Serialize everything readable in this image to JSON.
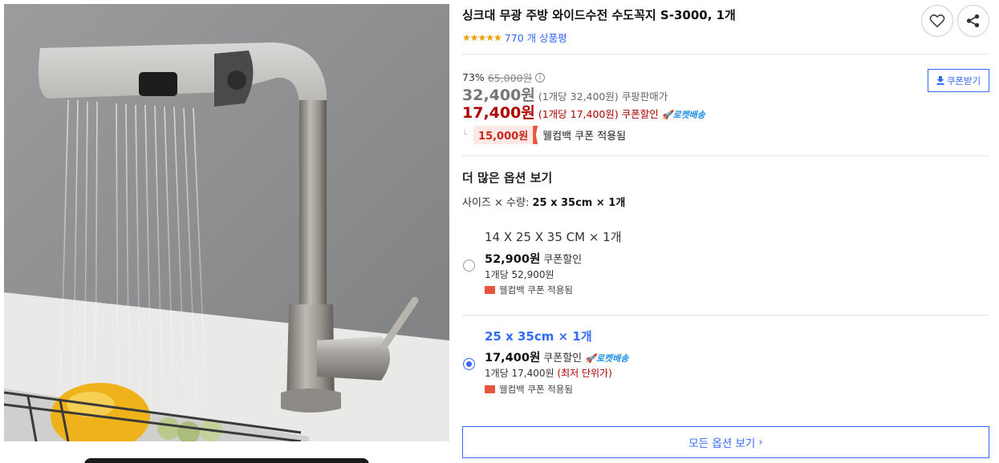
{
  "product": {
    "title": "싱크대 무광 주방 와이드수전 수도꼭지 S-3000, 1개",
    "stars": "★★★★★",
    "review_count": "770 개 상품평"
  },
  "icons": {
    "wishlist": "heart-icon",
    "share": "share-icon",
    "info": "info-icon",
    "download": "download-icon",
    "rocket": "rocket-icon",
    "coupon": "coupon-icon",
    "chevron": "chevron-right-icon"
  },
  "pricing": {
    "discount_rate": "73%",
    "original_price": "65,000원",
    "info_glyph": "i",
    "sale_price": "32,400원",
    "sale_unit": "(1개당 32,400원)",
    "sale_label": "쿠팡판매가",
    "coupon_price": "17,400원",
    "coupon_unit": "(1개당 17,400원)",
    "coupon_label": "쿠폰할인",
    "rocket_label": "🚀로켓배송",
    "coupon_button": "쿠폰받기",
    "welcome_amount": "15,000원",
    "welcome_text": "웰컴백 쿠폰 적용됨"
  },
  "options": {
    "heading": "더 많은 옵션 보기",
    "size_label": "사이즈 × 수량:",
    "size_value": "25 x 35cm × 1개",
    "items": [
      {
        "name": "14 X 25 X 35 CM × 1개",
        "price": "52,900원",
        "discount": "쿠폰할인",
        "unit": "1개당 52,900원",
        "unit_note": "",
        "coupon": "웰컴백 쿠폰 적용됨",
        "selected": false,
        "rocket": ""
      },
      {
        "name": "25 x 35cm × 1개",
        "price": "17,400원",
        "discount": "쿠폰할인",
        "unit": "1개당 17,400원",
        "unit_note": "(최저 단위가)",
        "coupon": "웰컴백 쿠폰 적용됨",
        "selected": true,
        "rocket": "🚀로켓배송"
      }
    ],
    "all_button": "모든 옵션 보기",
    "chevron": "›"
  },
  "colors": {
    "accent": "#346aff",
    "price_red": "#ae0000",
    "star": "#f29a00",
    "rocket": "#1d8ee6"
  }
}
